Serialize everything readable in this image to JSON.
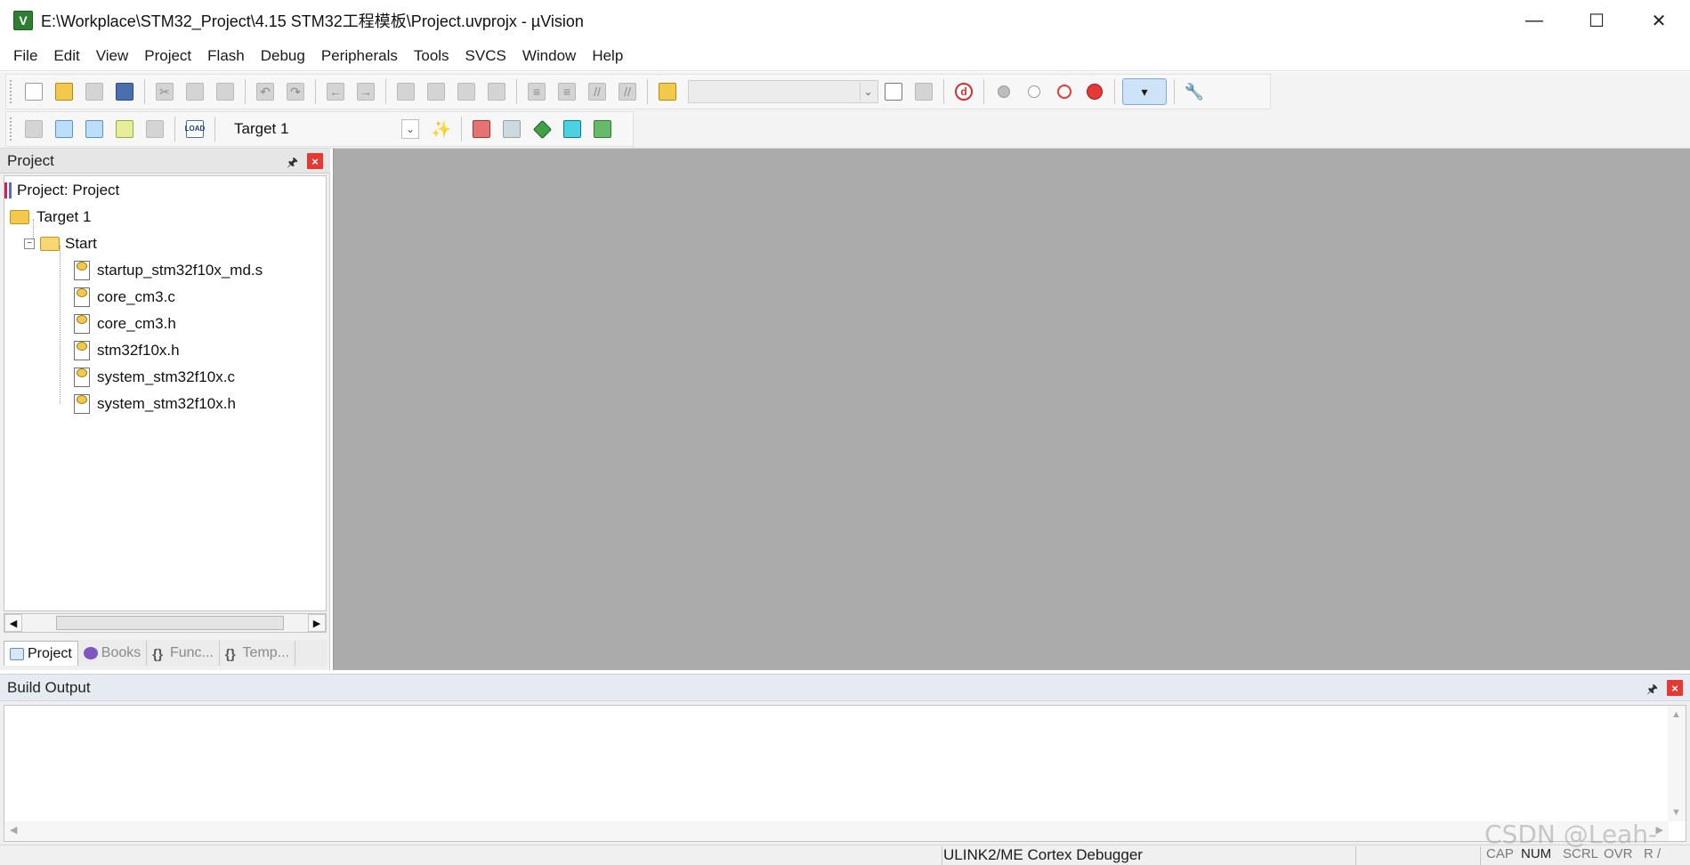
{
  "window": {
    "title": "E:\\Workplace\\STM32_Project\\4.15 STM32工程模板\\Project.uvprojx - µVision",
    "app_icon_glyph": "V",
    "minimize": "—",
    "maximize": "☐",
    "close": "✕"
  },
  "menu": [
    "File",
    "Edit",
    "View",
    "Project",
    "Flash",
    "Debug",
    "Peripherals",
    "Tools",
    "SVCS",
    "Window",
    "Help"
  ],
  "toolbar": {
    "target_select": "Target 1",
    "load_icon_text": "LOAD",
    "find_combo_value": ""
  },
  "project_panel": {
    "title": "Project",
    "pin": "🖈",
    "close": "×",
    "tree": {
      "root": "Project: Project",
      "target": "Target 1",
      "group": "Start",
      "files": [
        "startup_stm32f10x_md.s",
        "core_cm3.c",
        "core_cm3.h",
        "stm32f10x.h",
        "system_stm32f10x.c",
        "system_stm32f10x.h"
      ]
    },
    "tabs": [
      "Project",
      "Books",
      "Func...",
      "Temp..."
    ],
    "tab_func_glyph": "{}",
    "tab_temp_glyph": "{}"
  },
  "build_output": {
    "title": "Build Output",
    "pin": "🖈",
    "close": "×",
    "content": ""
  },
  "status": {
    "debugger": "ULINK2/ME Cortex Debugger",
    "indicators": [
      "CAP",
      "NUM",
      "SCRL",
      "OVR",
      "R /"
    ],
    "active_indicator": "NUM"
  },
  "watermark": "CSDN @Leah-",
  "colors": {
    "editor_bg": "#ababab",
    "close_button": "#e53935",
    "build_header": "#e6ebf2"
  }
}
